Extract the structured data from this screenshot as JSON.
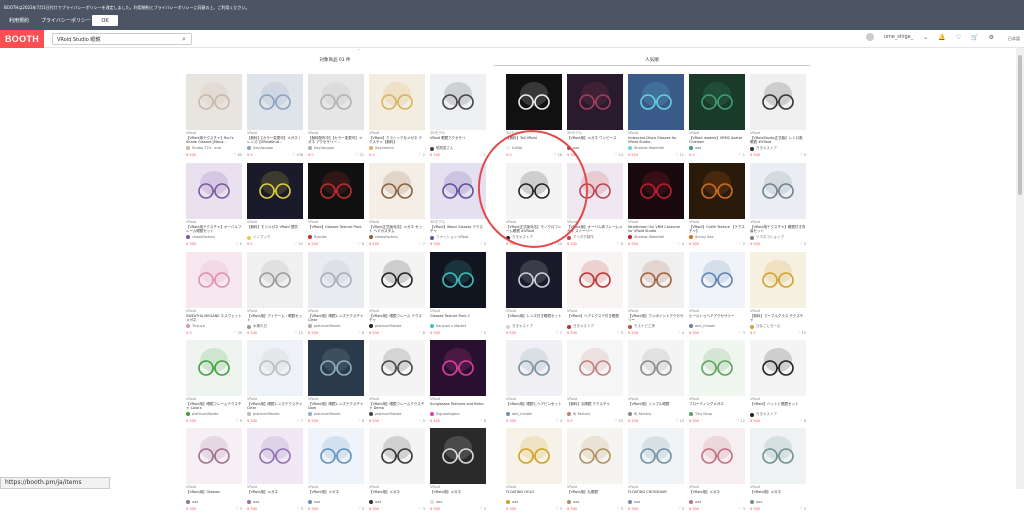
{
  "notice": {
    "text": "BOOTHは2023年7月1日付けでプライバシーポリシーを改定しました。利用規約とプライバシーポリシーに同意の上、ご利用ください。",
    "terms_link": "利用規約",
    "privacy_link": "プライバシーポリシー",
    "ok_label": "OK"
  },
  "header": {
    "logo": "BOOTH",
    "search_value": "VRoid Studio 眼鏡",
    "username": "ume_shige_",
    "lang": "日本語"
  },
  "sections": {
    "left_title": "対象商品 01 件",
    "right_title": "人気順"
  },
  "status_url": "https://booth.pm/ja/items",
  "items": [
    {
      "cat": "VRoid",
      "title": "【VRoid用テクスチャ】Ruri's Shade Glasses [Meca...",
      "shop": "Studio 724 - and",
      "price": "¥ 500",
      "likes": "60",
      "bg": "#e8e4df",
      "fg": "#c9b8a8"
    },
    {
      "cat": "VRoid",
      "title": "【無料】【カラー変更可】メガネ / レンズ【VRoidStud...",
      "shop": "SayUpuppe",
      "price": "¥ 0",
      "likes": "198",
      "bg": "#dfe3ea",
      "fg": "#8aa0c0"
    },
    {
      "cat": "VRoid",
      "title": "【無料配布中】【カラー変更可】メガネ アクセサリー...",
      "shop": "SayUpuppe",
      "price": "¥ 0",
      "likes": "21",
      "bg": "#e6e6e6",
      "fg": "#b0b0b8"
    },
    {
      "cat": "VRoid",
      "title": "【VRoid】クラシックなメガネ テクスチャ【無料】",
      "shop": "Saynamics",
      "price": "¥ 0",
      "likes": "2",
      "bg": "#f3ece0",
      "fg": "#d9b25e"
    },
    {
      "cat": "3Dモデル",
      "title": "VRoid 眼鏡アクセサリ",
      "shop": "眼鏡屋さん",
      "price": "¥ 100",
      "likes": "1",
      "bg": "#eef0f4",
      "fg": "#444"
    },
    {
      "cat": "3Dモデル",
      "title": "【無料】Tail VRoid",
      "shop": "ILUNA",
      "price": "¥ 0",
      "likes": "26",
      "bg": "#111",
      "fg": "#eee"
    },
    {
      "cat": "3Dモデル",
      "title": "【VRoid用】メガネ ワンピース",
      "shop": "aaa",
      "price": "¥ 300",
      "likes": "14",
      "bg": "#2a1a2e",
      "fg": "#a04060"
    },
    {
      "cat": "VRoid",
      "title": "Iridescent Disco Glasses for VRoid Studio",
      "shop": "Shallow Waterfall",
      "price": "¥ 500",
      "likes": "11",
      "bg": "#3a5a8a",
      "fg": "#6ad0e0"
    },
    {
      "cat": "VRoid",
      "title": "【VRoid models】VRM2 Avatar Chieleen",
      "shop": "aaa",
      "price": "¥ 0",
      "likes": "1",
      "bg": "#1a3a2a",
      "fg": "#40a070"
    },
    {
      "cat": "VRoid",
      "title": "【VRoidStudio正式版】レトロ風眼鏡 #VRoid",
      "shop": "ききゃストア",
      "price": "¥ 500",
      "likes": "9",
      "bg": "#f0f0f0",
      "fg": "#333"
    },
    {
      "cat": "VRoid",
      "title": "【VRoid用テクスチャ】オーバルフレーム眼鏡セット",
      "shop": "chaosFactory",
      "price": "¥ 300",
      "likes": "5",
      "bg": "#e9e0f0",
      "fg": "#7a5aa0"
    },
    {
      "cat": "VRoid",
      "title": "【無料】モジメガネ VRoid 提供",
      "shop": "イノブック",
      "price": "¥ 0",
      "likes": "52",
      "bg": "#1a1a2a",
      "fg": "#e0d040"
    },
    {
      "cat": "VRoid",
      "title": "【VRoid】Glasses Texture Pack",
      "shop": "flyonke",
      "price": "¥ 200",
      "likes": "8",
      "bg": "#101010",
      "fg": "#c03030"
    },
    {
      "cat": "VRoid",
      "title": "【VRoid正式版対応】メガネ セット ヘアカスタム",
      "shop": "chaosFactory",
      "price": "¥ 400",
      "likes": "7",
      "bg": "#f4eee6",
      "fg": "#8a6040"
    },
    {
      "cat": "3Dモデル",
      "title": "【VRoid】Wood Glasses テクスチャ",
      "shop": "ファッション VRoid",
      "price": "¥ 300",
      "likes": "3",
      "bg": "#e4e0f0",
      "fg": "#6050a0"
    },
    {
      "cat": "VRoid",
      "title": "【VRoid正式版対応】モノクロフレーム眼鏡 #VRoid",
      "shop": "ききゃストア",
      "price": "¥ 300",
      "likes": "10",
      "bg": "#f4f4f4",
      "fg": "#222"
    },
    {
      "cat": "VRoid",
      "title": "【VRoid用】オーバル赤フレームメガネ ストーリー",
      "shop": "アイダホ制作",
      "price": "¥ 200",
      "likes": "6",
      "bg": "#f0e8f0",
      "fg": "#c04050"
    },
    {
      "cat": "VRoid",
      "title": "Wraithmari Uni VRM Costume for VRoid Studio",
      "shop": "Shallow Waterfall",
      "price": "¥ 500",
      "likes": "4",
      "bg": "#1a0a10",
      "fg": "#c02030"
    },
    {
      "cat": "VRoid",
      "title": "【VRoid】Outfit Texture 【テクスチャ】",
      "shop": "Sunny Sea",
      "price": "¥ 300",
      "likes": "2",
      "bg": "#2a1a0a",
      "fg": "#d07020"
    },
    {
      "cat": "VRoid",
      "title": "【VRoid用テクスチャ】眼鏡付き衣装セット",
      "shop": "ソラネコショップ",
      "price": "¥ 500",
      "likes": "3",
      "bg": "#eaeef2",
      "fg": "#708090"
    },
    {
      "cat": "VRoid",
      "title": "SWEATHA MEGANE エスウェットメガネ",
      "shop": "Thyuyo",
      "price": "¥ 0",
      "likes": "30",
      "bg": "#f6e8ee",
      "fg": "#e090b0"
    },
    {
      "cat": "VRoid",
      "title": "【VRoid用】アイテーム・眼鏡セット",
      "shop": "木漏れ日",
      "price": "¥ 200",
      "likes": "12",
      "bg": "#f0f0f0",
      "fg": "#999"
    },
    {
      "cat": "VRoid",
      "title": "【VRoid用】眼鏡レンズテクスチャ Clear",
      "shop": "platinumRonde",
      "price": "¥ 200",
      "likes": "8",
      "bg": "#e8ecf0",
      "fg": "#aab"
    },
    {
      "cat": "VRoid",
      "title": "【VRoid用】眼鏡フレーム テクスチャ",
      "shop": "platinumRonde",
      "price": "¥ 200",
      "likes": "6",
      "bg": "#f4f4f4",
      "fg": "#222"
    },
    {
      "cat": "VRoid",
      "title": "Glasses Texture Pack 2",
      "shop": "Sanjuan's Market",
      "price": "¥ 300",
      "likes": "5",
      "bg": "#101520",
      "fg": "#40c0c0"
    },
    {
      "cat": "VRoid",
      "title": "【VRoid用】レンズ付き眼鏡セット",
      "shop": "ききゃストア",
      "price": "¥ 500",
      "likes": "7",
      "bg": "#1a1a2a",
      "fg": "#d0d0e0"
    },
    {
      "cat": "VRoid",
      "title": "【VRoid】ヘアエクステ付き眼鏡",
      "shop": "ききゃストア",
      "price": "¥ 500",
      "likes": "5",
      "bg": "#f8f4f4",
      "fg": "#c03030"
    },
    {
      "cat": "VRoid",
      "title": "【VRoid用】ワンポイントアクセサリー",
      "shop": "モスナビ工房",
      "price": "¥ 100",
      "likes": "4",
      "bg": "#f2f0ee",
      "fg": "#a06040"
    },
    {
      "cat": "VRoid",
      "title": "ヒールトゥヘアアクセサリー",
      "shop": "ami_minaki",
      "price": "¥ 300",
      "likes": "3",
      "bg": "#f0f4f8",
      "fg": "#6080b0"
    },
    {
      "cat": "VRoid",
      "title": "【無料】マーブルグラス テクスチャ",
      "shop": "ひなことろーぷ",
      "price": "¥ 0",
      "likes": "15",
      "bg": "#f6f0e0",
      "fg": "#d0a030"
    },
    {
      "cat": "VRoid",
      "title": "【VRoid用】眼鏡フレームテクスチャ Colors",
      "shop": "platinumRonde",
      "price": "¥ 200",
      "likes": "9",
      "bg": "#f0f4f0",
      "fg": "#40a040"
    },
    {
      "cat": "VRoid",
      "title": "【VRoid用】眼鏡レンズテクスチャ Clear",
      "shop": "platinumRonde",
      "price": "¥ 200",
      "likes": "7",
      "bg": "#eef2f6",
      "fg": "#bbb"
    },
    {
      "cat": "VRoid",
      "title": "【VRoid用】眼鏡レンズテクスチャ Dark",
      "shop": "platinumRonde",
      "price": "¥ 200",
      "likes": "6",
      "bg": "#2a3a4a",
      "fg": "#90b0c0"
    },
    {
      "cat": "VRoid",
      "title": "【VRoid用】眼鏡フレームテクスチャ Demo",
      "shop": "platinumRonde",
      "price": "¥ 200",
      "likes": "5",
      "bg": "#f4f4f4",
      "fg": "#444"
    },
    {
      "cat": "VRoid",
      "title": "Sunglasses Textures and Retro",
      "shop": "Signaalsigma",
      "price": "¥ 400",
      "likes": "8",
      "bg": "#2a1030",
      "fg": "#e040a0"
    },
    {
      "cat": "VRoid",
      "title": "【VRoid用】眼鏡とヘアピンセット",
      "shop": "ami_minaki",
      "price": "¥ 300",
      "likes": "4",
      "bg": "#f0f0f4",
      "fg": "#7a90a0"
    },
    {
      "cat": "VRoid",
      "title": "【無料】丸眼鏡 テクスチャ",
      "shop": "RJ Factory",
      "price": "¥ 0",
      "likes": "20",
      "bg": "#f6f6f6",
      "fg": "#c08080"
    },
    {
      "cat": "VRoid",
      "title": "【VRoid用】シンプル眼鏡",
      "shop": "RJ Factory",
      "price": "¥ 100",
      "likes": "10",
      "bg": "#f4f4f4",
      "fg": "#888"
    },
    {
      "cat": "VRoid",
      "title": "フローティングメガネ",
      "shop": "Tiny Drop",
      "price": "¥ 300",
      "likes": "12",
      "bg": "#f0f6f0",
      "fg": "#60a060"
    },
    {
      "cat": "VRoid",
      "title": "【VRoid】ハットと眼鏡セット",
      "shop": "ききゃストア",
      "price": "¥ 500",
      "likes": "6",
      "bg": "#f4f4f4",
      "fg": "#222"
    },
    {
      "cat": "VRoid",
      "title": "【VRoid用】Glasses",
      "shop": "aaa",
      "price": "¥ 300",
      "likes": "3",
      "bg": "#f6f0f4",
      "fg": "#a07090"
    },
    {
      "cat": "VRoid",
      "title": "【VRoid用】メガネ",
      "shop": "aaa",
      "price": "¥ 300",
      "likes": "3",
      "bg": "#f0e8f4",
      "fg": "#9070b0"
    },
    {
      "cat": "VRoid",
      "title": "【VRoid用】メガネ",
      "shop": "aaa",
      "price": "¥ 300",
      "likes": "3",
      "bg": "#eef4fa",
      "fg": "#6090c0"
    },
    {
      "cat": "VRoid",
      "title": "【VRoid用】メガネ",
      "shop": "aaa",
      "price": "¥ 300",
      "likes": "3",
      "bg": "#f4f4f4",
      "fg": "#333"
    },
    {
      "cat": "VRoid",
      "title": "【VRoid用】メガネ",
      "shop": "aaa",
      "price": "¥ 300",
      "likes": "3",
      "bg": "#2a2a2a",
      "fg": "#ddd"
    },
    {
      "cat": "VRoid",
      "title": "FLOATING HOLO",
      "shop": "aaa",
      "price": "¥ 300",
      "likes": "3",
      "bg": "#f6f2e8",
      "fg": "#d0a020"
    },
    {
      "cat": "VRoid",
      "title": "【VRoid用】丸眼鏡",
      "shop": "aaa",
      "price": "¥ 300",
      "likes": "3",
      "bg": "#f6f4f0",
      "fg": "#b09060"
    },
    {
      "cat": "VRoid",
      "title": "FLOATING CROSSHAIR",
      "shop": "aaa",
      "price": "¥ 300",
      "likes": "3",
      "bg": "#f0f4f6",
      "fg": "#7090a0"
    },
    {
      "cat": "VRoid",
      "title": "【VRoid用】メガネ",
      "shop": "aaa",
      "price": "¥ 300",
      "likes": "3",
      "bg": "#f6eef0",
      "fg": "#c07080"
    },
    {
      "cat": "VRoid",
      "title": "【VRoid用】メガネ",
      "shop": "aaa",
      "price": "¥ 300",
      "likes": "3",
      "bg": "#eef2f2",
      "fg": "#709090"
    }
  ]
}
